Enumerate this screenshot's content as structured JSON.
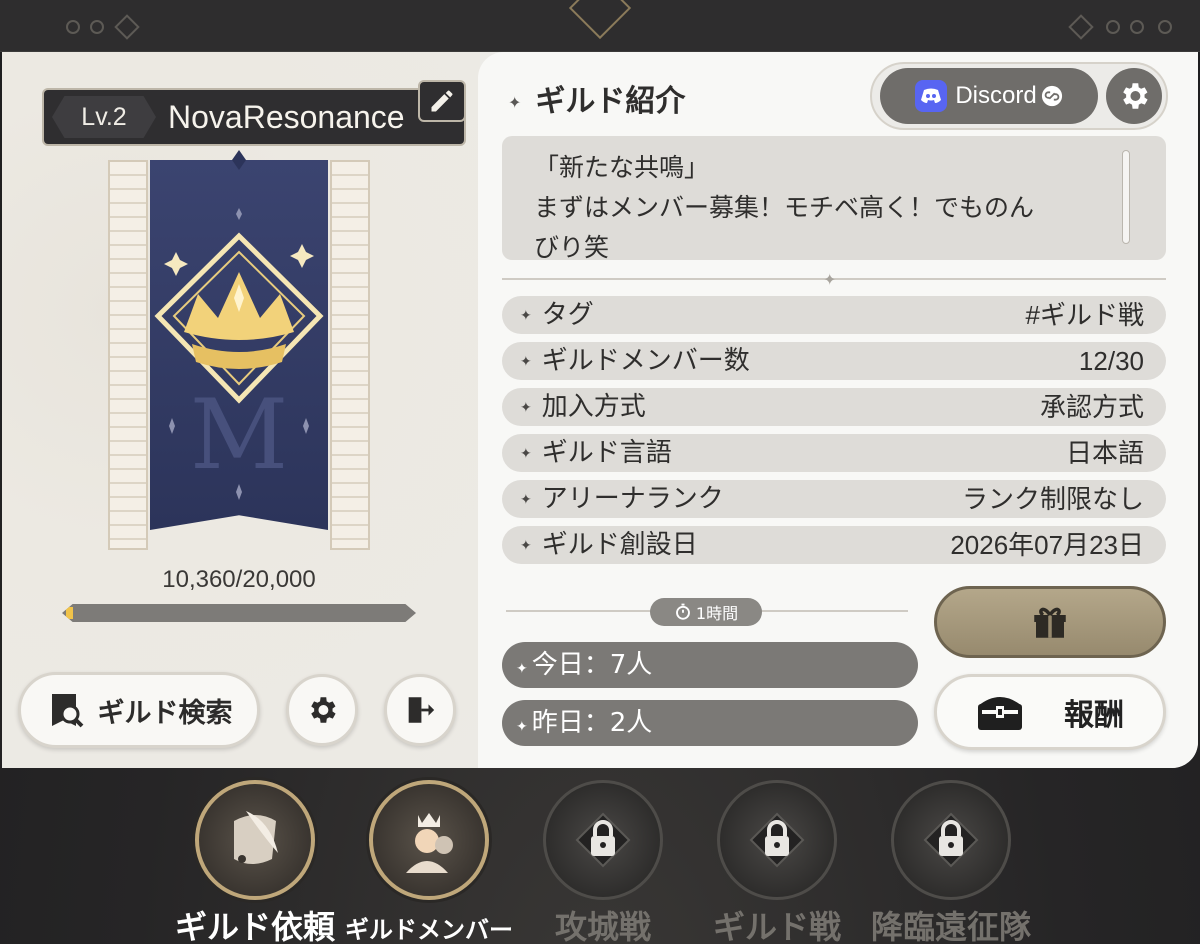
{
  "guild": {
    "level": "Lv.2",
    "name": "NovaResonance",
    "exp_text": "10,360/20,000",
    "exp_progress": 0.02
  },
  "left_buttons": {
    "search_label": "ギルド検索"
  },
  "intro": {
    "title": "ギルド紹介",
    "discord_label": "Discord",
    "lines": [
      "「新たな共鳴」",
      "まずはメンバー募集！モチベ高く！でものん",
      "びり笑"
    ]
  },
  "info": [
    {
      "key": "タグ",
      "value": "#ギルド戦"
    },
    {
      "key": "ギルドメンバー数",
      "value": "12/30"
    },
    {
      "key": "加入方式",
      "value": "承認方式"
    },
    {
      "key": "ギルド言語",
      "value": "日本語"
    },
    {
      "key": "アリーナランク",
      "value": "ランク制限なし"
    },
    {
      "key": "ギルド創設日",
      "value": "2026年07月23日"
    }
  ],
  "activity": {
    "timer": "1時間",
    "today": "今日：7人",
    "yesterday": "昨日：2人"
  },
  "reward_label": "報酬",
  "nav": [
    {
      "label": "ギルド依頼",
      "state": "active"
    },
    {
      "label": "ギルドメンバー",
      "state": "active"
    },
    {
      "label": "攻城戦",
      "state": "locked"
    },
    {
      "label": "ギルド戦",
      "state": "locked"
    },
    {
      "label": "降臨遠征隊",
      "state": "locked"
    }
  ],
  "colors": {
    "accent_gold": "#f0c34a",
    "discord": "#5865f2",
    "banner_blue": "#2c345a"
  }
}
